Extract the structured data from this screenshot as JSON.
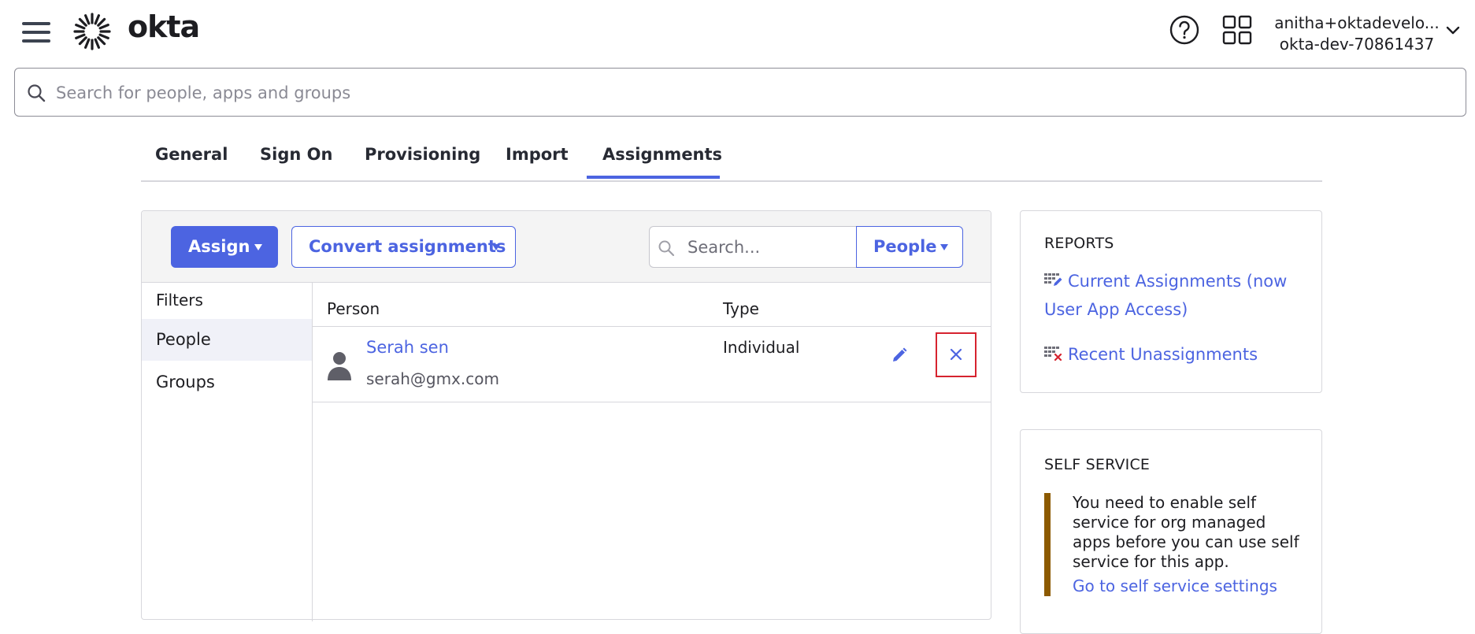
{
  "header": {
    "brand": "okta",
    "user_email": "anitha+oktadevelo...",
    "org_name": "okta-dev-70861437",
    "icons": [
      "hamburger-menu-icon",
      "okta-sunburst-icon",
      "help-icon",
      "app-grid-icon",
      "chevron-down-icon"
    ]
  },
  "global_search": {
    "placeholder": "Search for people, apps and groups"
  },
  "tabs": [
    {
      "label": "General"
    },
    {
      "label": "Sign On"
    },
    {
      "label": "Provisioning"
    },
    {
      "label": "Import"
    },
    {
      "label": "Assignments",
      "active": true
    }
  ],
  "toolbar": {
    "assign_label": "Assign",
    "convert_label": "Convert assignments",
    "search_placeholder": "Search...",
    "people_label": "People"
  },
  "filters": {
    "title": "Filters",
    "items": [
      {
        "label": "People",
        "active": true
      },
      {
        "label": "Groups"
      }
    ]
  },
  "table": {
    "columns": [
      "Person",
      "Type"
    ],
    "rows": [
      {
        "name": "Serah sen",
        "email": "serah@gmx.com",
        "type": "Individual"
      }
    ]
  },
  "reports": {
    "title": "REPORTS",
    "current_line1": "Current Assignments (now",
    "current_line2": "User App Access)",
    "recent": "Recent Unassignments"
  },
  "self_service": {
    "title": "SELF SERVICE",
    "line1": "You need to enable self",
    "line2": "service for org managed",
    "line3": "apps before you can use self",
    "line4": "service for this app.",
    "link": "Go to self service settings"
  },
  "colors": {
    "primary": "#4c64e1",
    "danger": "#d6232f",
    "warning_bar": "#8c5a00",
    "toolbar_bg": "#f4f4f4"
  }
}
